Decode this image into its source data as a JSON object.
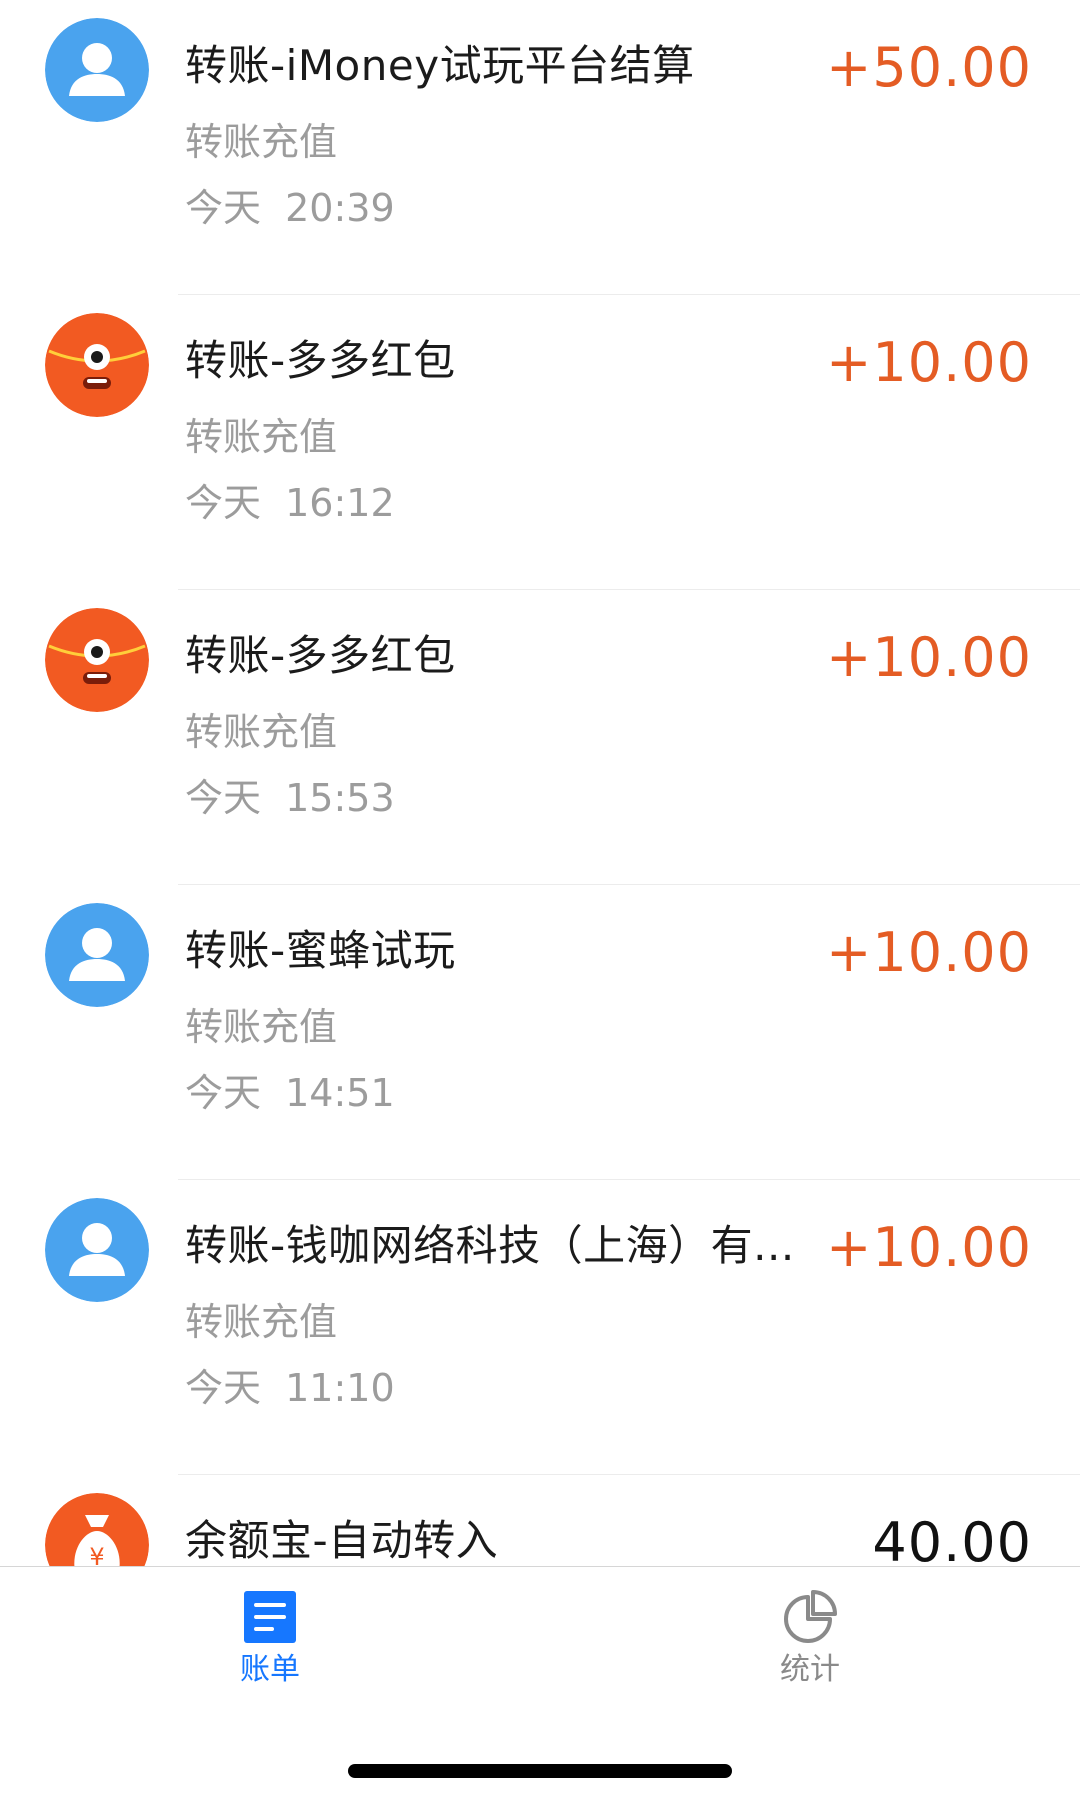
{
  "colors": {
    "income": "#e45c24",
    "neutral_amount": "#111111",
    "tab_active": "#1677ff",
    "tab_inactive": "#8a8a8a",
    "avatar_blue": "#4aa3ee",
    "avatar_orange": "#f25a22"
  },
  "transactions": [
    {
      "title": "转账-iMoney试玩平台结算",
      "category": "转账充值",
      "date": "今天",
      "time": "20:39",
      "amount": "+50.00",
      "avatar_icon": "person-avatar-icon",
      "type": "income"
    },
    {
      "title": "转账-多多红包",
      "category": "转账充值",
      "date": "今天",
      "time": "16:12",
      "amount": "+10.00",
      "avatar_icon": "red-packet-mascot-icon",
      "type": "income"
    },
    {
      "title": "转账-多多红包",
      "category": "转账充值",
      "date": "今天",
      "time": "15:53",
      "amount": "+10.00",
      "avatar_icon": "red-packet-mascot-icon",
      "type": "income"
    },
    {
      "title": "转账-蜜蜂试玩",
      "category": "转账充值",
      "date": "今天",
      "time": "14:51",
      "amount": "+10.00",
      "avatar_icon": "person-avatar-icon",
      "type": "income"
    },
    {
      "title": "转账-钱咖网络科技（上海）有...",
      "category": "转账充值",
      "date": "今天",
      "time": "11:10",
      "amount": "+10.00",
      "avatar_icon": "person-avatar-icon",
      "type": "income"
    },
    {
      "title": "余额宝-自动转入",
      "category": "",
      "date": "",
      "time": "",
      "amount": "40.00",
      "avatar_icon": "money-bag-icon",
      "type": "neutral"
    }
  ],
  "tabbar": {
    "bills_label": "账单",
    "bills_icon": "bill-list-icon",
    "bills_active": true,
    "stats_label": "统计",
    "stats_icon": "pie-chart-icon",
    "stats_active": false
  }
}
